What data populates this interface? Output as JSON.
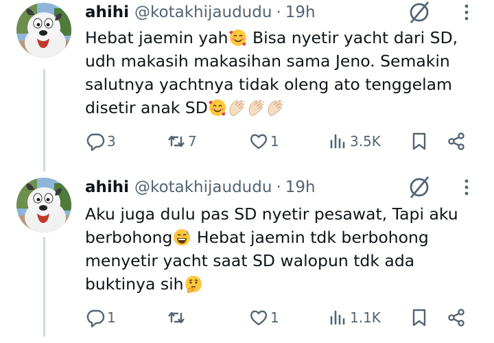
{
  "tweets": [
    {
      "name": "ahihi",
      "handle": "@kotakhijaududu",
      "separator": "·",
      "time": "19h",
      "text_parts": [
        "Hebat jaemin yah",
        " Bisa nyetir yacht dari SD, udh makasih makasihan sama Jeno. Semakin salutnya yachtnya tidak oleng ato tenggelam disetir anak SD"
      ],
      "emojis": [
        "smiling-face-with-hearts",
        "clapping-hands",
        "clapping-hands",
        "clapping-hands",
        "smiling-face-with-hearts"
      ],
      "replies": "3",
      "reposts": "7",
      "likes": "1",
      "views": "3.5K"
    },
    {
      "name": "ahihi",
      "handle": "@kotakhijaududu",
      "separator": "·",
      "time": "19h",
      "text_parts": [
        "Aku juga dulu pas SD nyetir pesawat, Tapi aku berbohong",
        " Hebat jaemin tdk berbohong menyetir yacht saat SD walopun tdk ada buktinya sih"
      ],
      "emojis": [
        "grinning-sweat",
        "thinking-face"
      ],
      "replies": "1",
      "reposts": "",
      "likes": "1",
      "views": "1.1K"
    }
  ],
  "colors": {
    "text": "#0f1419",
    "secondary": "#536471",
    "thread_line": "#cfd9de",
    "background": "#ffffff"
  },
  "icons": [
    "reply-icon",
    "repost-icon",
    "like-icon",
    "views-icon",
    "bookmark-icon",
    "share-icon",
    "grok-slash-icon",
    "more-icon"
  ]
}
